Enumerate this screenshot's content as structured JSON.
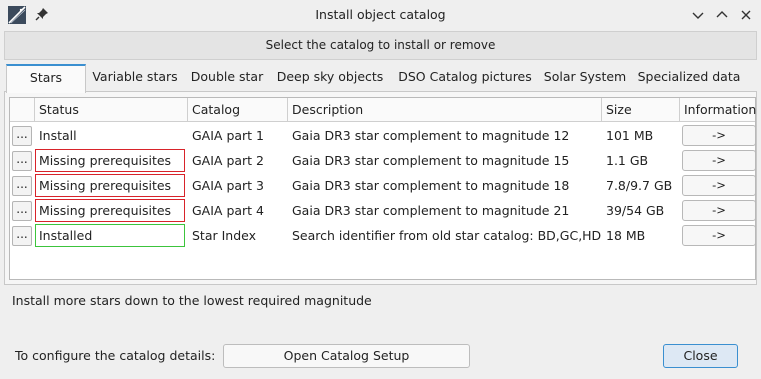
{
  "window": {
    "title": "Install object catalog"
  },
  "subheader": "Select the catalog to install or remove",
  "tabs": [
    {
      "label": "Stars",
      "active": true
    },
    {
      "label": "Variable stars",
      "active": false
    },
    {
      "label": "Double star",
      "active": false
    },
    {
      "label": "Deep sky objects",
      "active": false
    },
    {
      "label": "DSO Catalog pictures",
      "active": false
    },
    {
      "label": "Solar System",
      "active": false
    },
    {
      "label": "Specialized data",
      "active": false
    }
  ],
  "table": {
    "headers": {
      "status": "Status",
      "catalog": "Catalog",
      "description": "Description",
      "size": "Size",
      "information": "Information"
    },
    "rows": [
      {
        "dots": "...",
        "status": "Install",
        "status_state": "none",
        "catalog": "GAIA part 1",
        "description": "Gaia DR3 star complement to magnitude 12",
        "size": "101 MB",
        "info": "->"
      },
      {
        "dots": "...",
        "status": "Missing prerequisites",
        "status_state": "missing",
        "catalog": "GAIA part 2",
        "description": "Gaia DR3 star complement to magnitude 15",
        "size": "1.1 GB",
        "info": "->"
      },
      {
        "dots": "...",
        "status": "Missing prerequisites",
        "status_state": "missing",
        "catalog": "GAIA part 3",
        "description": "Gaia DR3 star complement to magnitude 18",
        "size": "7.8/9.7 GB",
        "info": "->"
      },
      {
        "dots": "...",
        "status": "Missing prerequisites",
        "status_state": "missing",
        "catalog": "GAIA part 4",
        "description": "Gaia DR3 star complement to magnitude 21",
        "size": "39/54 GB",
        "info": "->"
      },
      {
        "dots": "...",
        "status": "Installed",
        "status_state": "installed",
        "catalog": "Star Index",
        "description": "Search identifier from old star catalog: BD,GC,HD,S",
        "size": "18 MB",
        "info": "->"
      }
    ]
  },
  "info_text": "Install more stars down to the lowest required magnitude",
  "config": {
    "label": "To configure the catalog details:",
    "button": "Open Catalog Setup"
  },
  "close_button": "Close",
  "colors": {
    "accent": "#3a8fd0",
    "missing": "#d8232a",
    "installed": "#3cc43c"
  }
}
